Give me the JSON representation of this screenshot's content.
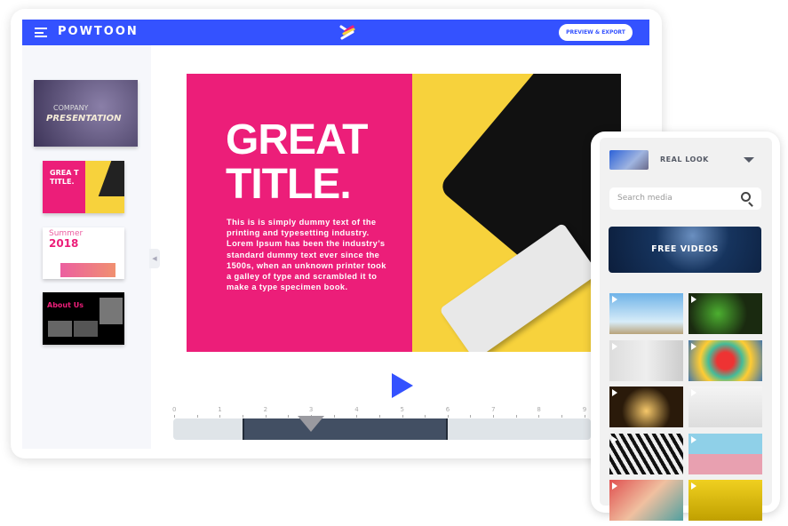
{
  "header": {
    "logo": "POWTOON",
    "export_label": "PREVIEW & EXPORT",
    "accent": "#3452ff"
  },
  "sidebar": {
    "thumbnails": [
      {
        "line1": "COMPANY",
        "line2": "PRESENTATION"
      },
      {
        "line1": "GREA T",
        "line2": "TITLE."
      },
      {
        "line1": "Summer",
        "line2": "2018"
      },
      {
        "line1": "About Us"
      }
    ]
  },
  "slide": {
    "title_line1": "GREAT",
    "title_line2": "TITLE.",
    "body": "This is is simply dummy text of the printing and typesetting industry. Lorem Ipsum has been the industry’s standard dummy text ever since the 1500s, when an unknown printer took a galley of type and scrambled it to make a type specimen book.",
    "pink": "#ec1e79",
    "yellow": "#f7d23c"
  },
  "timeline": {
    "ticks": [
      "0",
      "1",
      "2",
      "3",
      "4",
      "5",
      "6",
      "7",
      "8",
      "9"
    ],
    "clip_start": 1.5,
    "clip_end": 6,
    "playhead": 3
  },
  "media_panel": {
    "category": "REAL LOOK",
    "search_placeholder": "Search media",
    "banner": "FREE VIDEOS",
    "items": [
      "sky-jump",
      "lizard",
      "people",
      "umbrellas",
      "sparkler-cool",
      "keyboard",
      "zebra",
      "cupcakes",
      "abstract",
      "yellow"
    ]
  }
}
